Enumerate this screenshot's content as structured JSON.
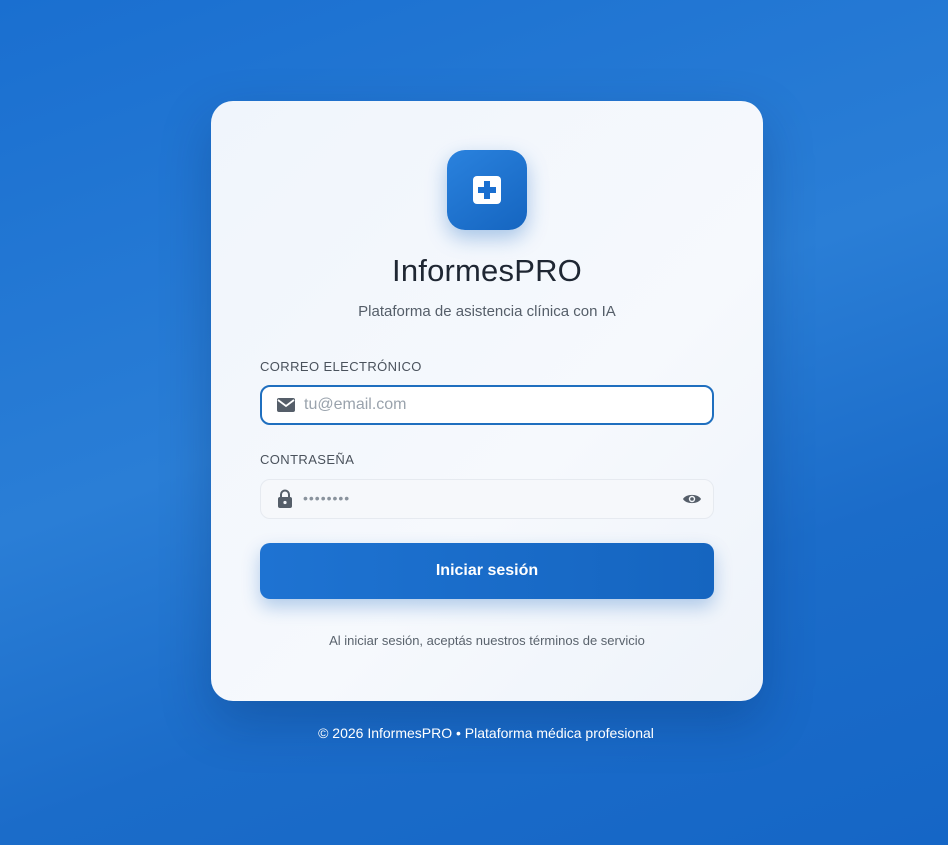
{
  "app": {
    "name": "InformesPRO",
    "subtitle": "Plataforma de asistencia clínica con IA"
  },
  "form": {
    "email_label": "CORREO ELECTRÓNICO",
    "email_placeholder": "tu@email.com",
    "email_value": "",
    "password_label": "CONTRASEÑA",
    "password_placeholder": "••••••••",
    "password_value": "",
    "submit_label": "Iniciar sesión",
    "terms_text": "Al iniciar sesión, aceptás nuestros términos de servicio"
  },
  "footer": {
    "text": "© 2026 InformesPRO • Plataforma médica profesional"
  },
  "icons": {
    "logo": "medical-cross-icon",
    "email": "mail-icon",
    "password": "lock-icon",
    "toggle": "eye-icon"
  },
  "colors": {
    "accent": "#1565c0",
    "background": "#1a6fd0",
    "card": "#f4f7fc"
  }
}
